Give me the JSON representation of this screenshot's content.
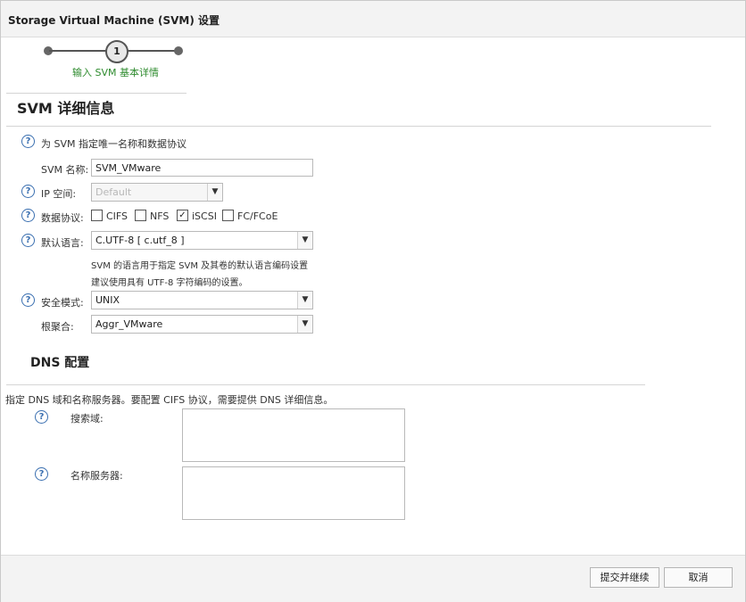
{
  "window": {
    "title": "Storage Virtual Machine (SVM) 设置"
  },
  "wizard": {
    "step_number": "1",
    "step_label": "输入 SVM 基本详情"
  },
  "svm_details": {
    "heading": "SVM 详细信息",
    "intro": "为 SVM 指定唯一名称和数据协议",
    "name_label": "SVM 名称:",
    "name_value": "SVM_VMware",
    "ipspace_label": "IP 空间:",
    "ipspace_value": "Default",
    "protocols_label": "数据协议:",
    "protocols": [
      {
        "label": "CIFS",
        "checked": false
      },
      {
        "label": "NFS",
        "checked": false
      },
      {
        "label": "iSCSI",
        "checked": true
      },
      {
        "label": "FC/FCoE",
        "checked": false
      }
    ],
    "language_label": "默认语言:",
    "language_value": "C.UTF-8 [ c.utf_8 ]",
    "language_note_1": "SVM 的语言用于指定 SVM 及其卷的默认语言编码设置",
    "language_note_2": "建议使用具有 UTF-8 字符编码的设置。",
    "security_label": "安全模式:",
    "security_value": "UNIX",
    "root_aggr_label": "根聚合:",
    "root_aggr_value": "Aggr_VMware"
  },
  "dns": {
    "heading": "DNS 配置",
    "intro": "指定 DNS 域和名称服务器。要配置 CIFS 协议，需要提供 DNS 详细信息。",
    "search_domain_label": "搜索域:",
    "name_servers_label": "名称服务器:"
  },
  "footer": {
    "submit_label": "提交并继续",
    "cancel_label": "取消"
  }
}
